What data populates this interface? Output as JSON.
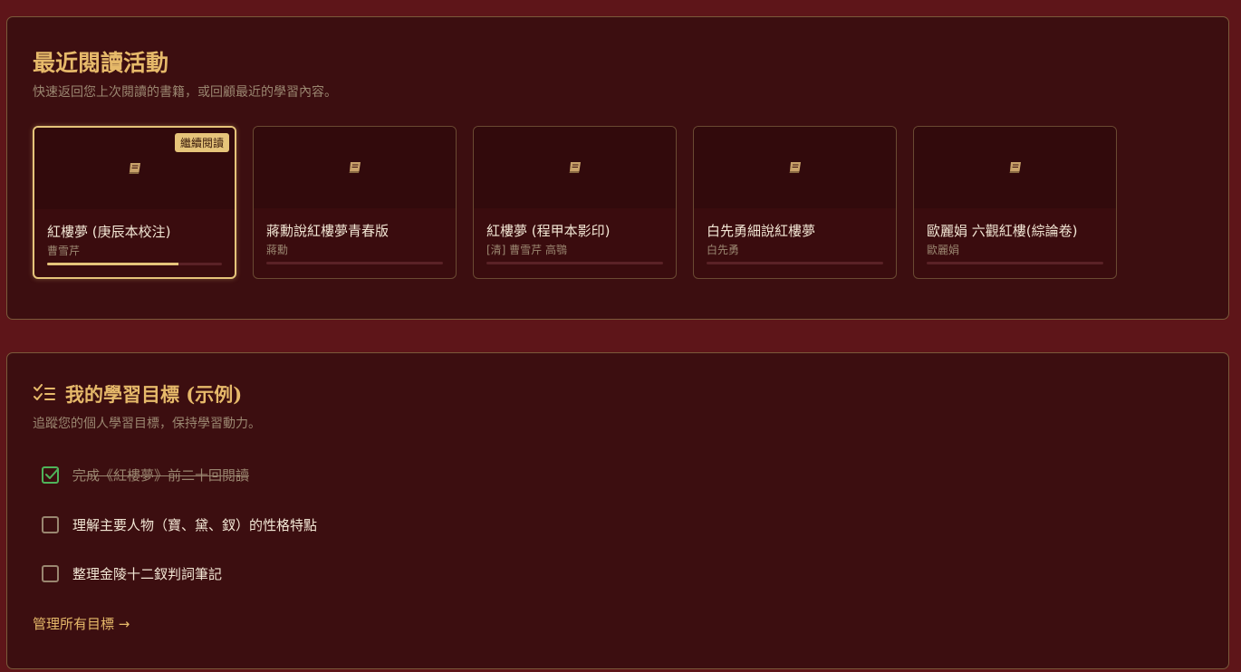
{
  "recent": {
    "title": "最近閱讀活動",
    "subtitle": "快速返回您上次閱讀的書籍，或回顧最近的學習內容。",
    "continue_badge": "繼續閱讀",
    "books": [
      {
        "title": "紅樓夢 (庚辰本校注)",
        "author": "曹雪芹",
        "progress": 0.75,
        "icon": "book-icon"
      },
      {
        "title": "蔣勳說紅樓夢青春版",
        "author": "蔣勳",
        "progress": 0,
        "icon": "book-icon"
      },
      {
        "title": "紅樓夢 (程甲本影印)",
        "author": "[清] 曹雪芹 高鶚",
        "progress": 0,
        "icon": "book-icon"
      },
      {
        "title": "白先勇細說紅樓夢",
        "author": "白先勇",
        "progress": 0,
        "icon": "book-icon"
      },
      {
        "title": "歐麗娟 六觀紅樓(綜論卷)",
        "author": "歐麗娟",
        "progress": 0,
        "icon": "book-icon"
      }
    ]
  },
  "goals": {
    "title": "我的學習目標 (示例)",
    "title_icon": "checklist-icon",
    "subtitle": "追蹤您的個人學習目標，保持學習動力。",
    "items": [
      {
        "label": "完成《紅樓夢》前二十回閱讀",
        "checked": true
      },
      {
        "label": "理解主要人物（寶、黛、釵）的性格特點",
        "checked": false
      },
      {
        "label": "整理金陵十二釵判詞筆記",
        "checked": false
      }
    ],
    "manage_link": "管理所有目標 →"
  },
  "colors": {
    "page_bg": "#5e1519",
    "panel_bg": "#3c0e10",
    "accent": "#e6b96a",
    "check_green": "#4fb45a"
  }
}
